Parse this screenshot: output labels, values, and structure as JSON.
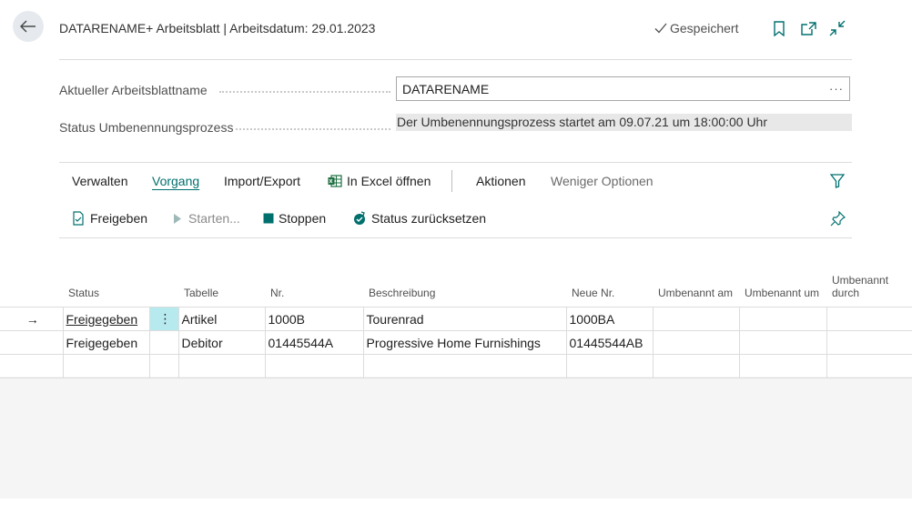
{
  "header": {
    "title": "DATARENAME+ Arbeitsblatt | Arbeitsdatum: 29.01.2023",
    "saved_label": "Gespeichert"
  },
  "fields": {
    "sheet_name_label": "Aktueller Arbeitsblattname",
    "sheet_name_value": "DATARENAME",
    "sheet_name_more": "···",
    "status_label": "Status Umbenennungsprozess",
    "status_value": "Der Umbenennungsprozess startet am 09.07.21 um 18:00:00 Uhr"
  },
  "menu": {
    "items": [
      "Verwalten",
      "Vorgang",
      "Import/Export",
      "In Excel öffnen",
      "Aktionen",
      "Weniger Optionen"
    ]
  },
  "actions": {
    "items": [
      "Freigeben",
      "Starten...",
      "Stoppen",
      "Status zurücksetzen"
    ]
  },
  "grid": {
    "columns": [
      "Status",
      "Tabelle",
      "Nr.",
      "Beschreibung",
      "Neue Nr.",
      "Umbenannt am",
      "Umbenannt um",
      "Umbenannt durch"
    ],
    "rows": [
      {
        "status": "Freigegeben",
        "tabelle": "Artikel",
        "nr": "1000B",
        "beschreibung": "Tourenrad",
        "neue_nr": "1000BA",
        "am": "",
        "um": "",
        "durch": ""
      },
      {
        "status": "Freigegeben",
        "tabelle": "Debitor",
        "nr": "01445544A",
        "beschreibung": "Progressive Home Furnishings",
        "neue_nr": "01445544AB",
        "am": "",
        "um": "",
        "durch": ""
      }
    ],
    "row_indicator": "→",
    "row_menu": "⋮"
  },
  "colors": {
    "accent": "#00706e",
    "selected_cell": "#b7eaee",
    "readonly_bg": "#e8e8e8"
  }
}
